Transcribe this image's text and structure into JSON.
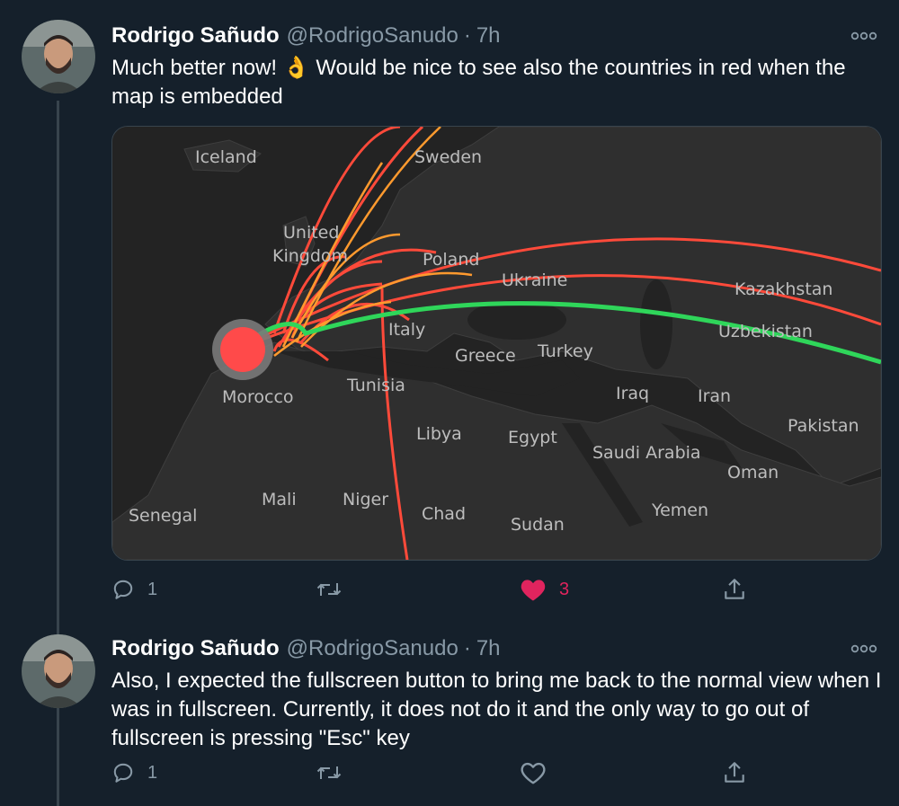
{
  "tweets": [
    {
      "author_name": "Rodrigo Sañudo",
      "handle": "@RodrigoSanudo",
      "separator": "·",
      "time": "7h",
      "text_before_emoji": "Much better now! ",
      "emoji": "👌",
      "text_after_emoji": " Would be nice to see also the countries in red when the map is embedded",
      "reply_count": "1",
      "retweet_count": "",
      "like_count": "3",
      "liked": true
    },
    {
      "author_name": "Rodrigo Sañudo",
      "handle": "@RodrigoSanudo",
      "separator": "·",
      "time": "7h",
      "text": "Also, I expected the fullscreen button to bring me back to the normal view when I was in fullscreen. Currently, it does not do it and the only way to go out of fullscreen is pressing \"Esc\" key",
      "reply_count": "1",
      "retweet_count": "",
      "like_count": "",
      "liked": false
    }
  ],
  "map": {
    "labels": {
      "iceland": "Iceland",
      "sweden": "Sweden",
      "united": "United",
      "kingdom": "Kingdom",
      "poland": "Poland",
      "ukraine": "Ukraine",
      "kazakhstan": "Kazakhstan",
      "uzbekistan": "Uzbekistan",
      "italy": "Italy",
      "greece": "Greece",
      "turkey": "Turkey",
      "morocco": "Morocco",
      "tunisia": "Tunisia",
      "iraq": "Iraq",
      "iran": "Iran",
      "pakistan": "Pakistan",
      "libya": "Libya",
      "egypt": "Egypt",
      "saudi_arabia": "Saudi Arabia",
      "oman": "Oman",
      "mali": "Mali",
      "niger": "Niger",
      "senegal": "Senegal",
      "chad": "Chad",
      "sudan": "Sudan",
      "yemen": "Yemen"
    },
    "colors": {
      "land": "#2f2f2f",
      "water": "#1f1f1f",
      "red_route": "#ff4a3a",
      "orange_route": "#ff9a2e",
      "green_route": "#2fd65a",
      "origin_marker": "#ff4a4a"
    }
  },
  "colors": {
    "background": "#15202b",
    "text": "#ffffff",
    "muted": "#8899a6",
    "like": "#e0245e",
    "thread_line": "#38444d"
  }
}
